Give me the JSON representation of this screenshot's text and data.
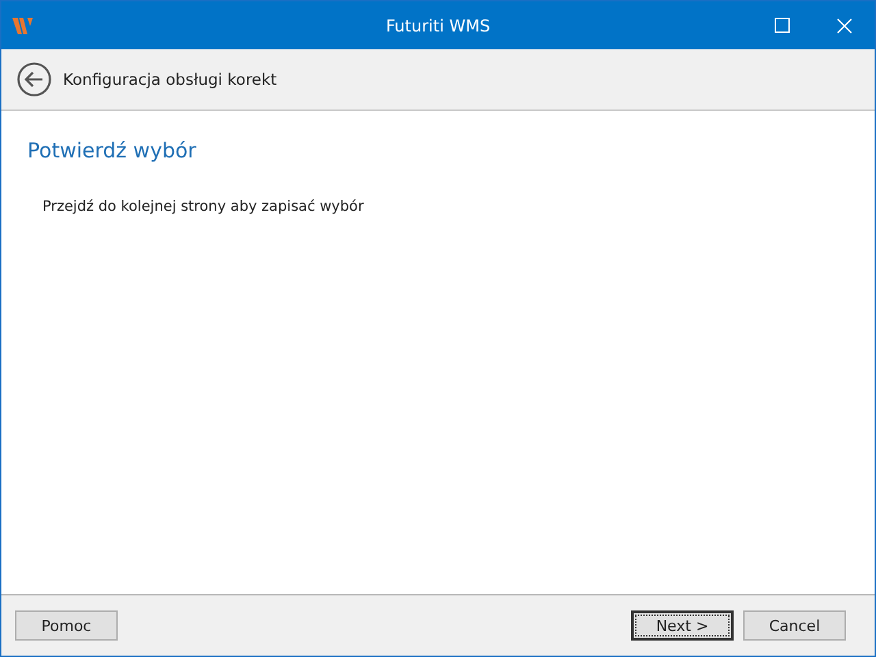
{
  "window": {
    "title": "Futuriti WMS"
  },
  "header": {
    "title": "Konfiguracja obsługi korekt"
  },
  "page": {
    "heading": "Potwierdź wybór",
    "text": "Przejdź do kolejnej strony aby zapisać wybór"
  },
  "left_buttons": [
    {
      "label": "Pomoc",
      "default": false
    }
  ],
  "right_buttons": [
    {
      "label": "Next >",
      "default": true
    },
    {
      "label": "Cancel",
      "default": false
    }
  ]
}
